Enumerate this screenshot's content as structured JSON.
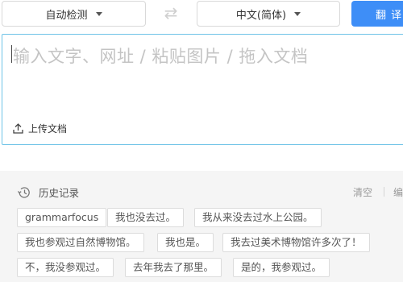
{
  "toolbar": {
    "source_language": "自动检测",
    "target_language": "中文(简体)",
    "swap_icon": "⇄",
    "translate_label": "翻 译"
  },
  "input": {
    "placeholder": "输入文字、网址 / 粘贴图片 / 拖入文档",
    "upload_label": "上传文档"
  },
  "history": {
    "title": "历史记录",
    "clear_label": "清空",
    "edit_label": "编",
    "items": [
      "grammarfocus",
      "我也没去过。",
      "我从来没去过水上公园。",
      "我也参观过自然博物馆。",
      "我也是。",
      "我去过美术博物馆许多次了！",
      "不，我没参观过。",
      "去年我去了那里。",
      "是的，我参观过。"
    ]
  },
  "colors": {
    "accent": "#3e8ef7",
    "input_border": "#6ec3e7",
    "history_bg": "#f5f5f5"
  }
}
